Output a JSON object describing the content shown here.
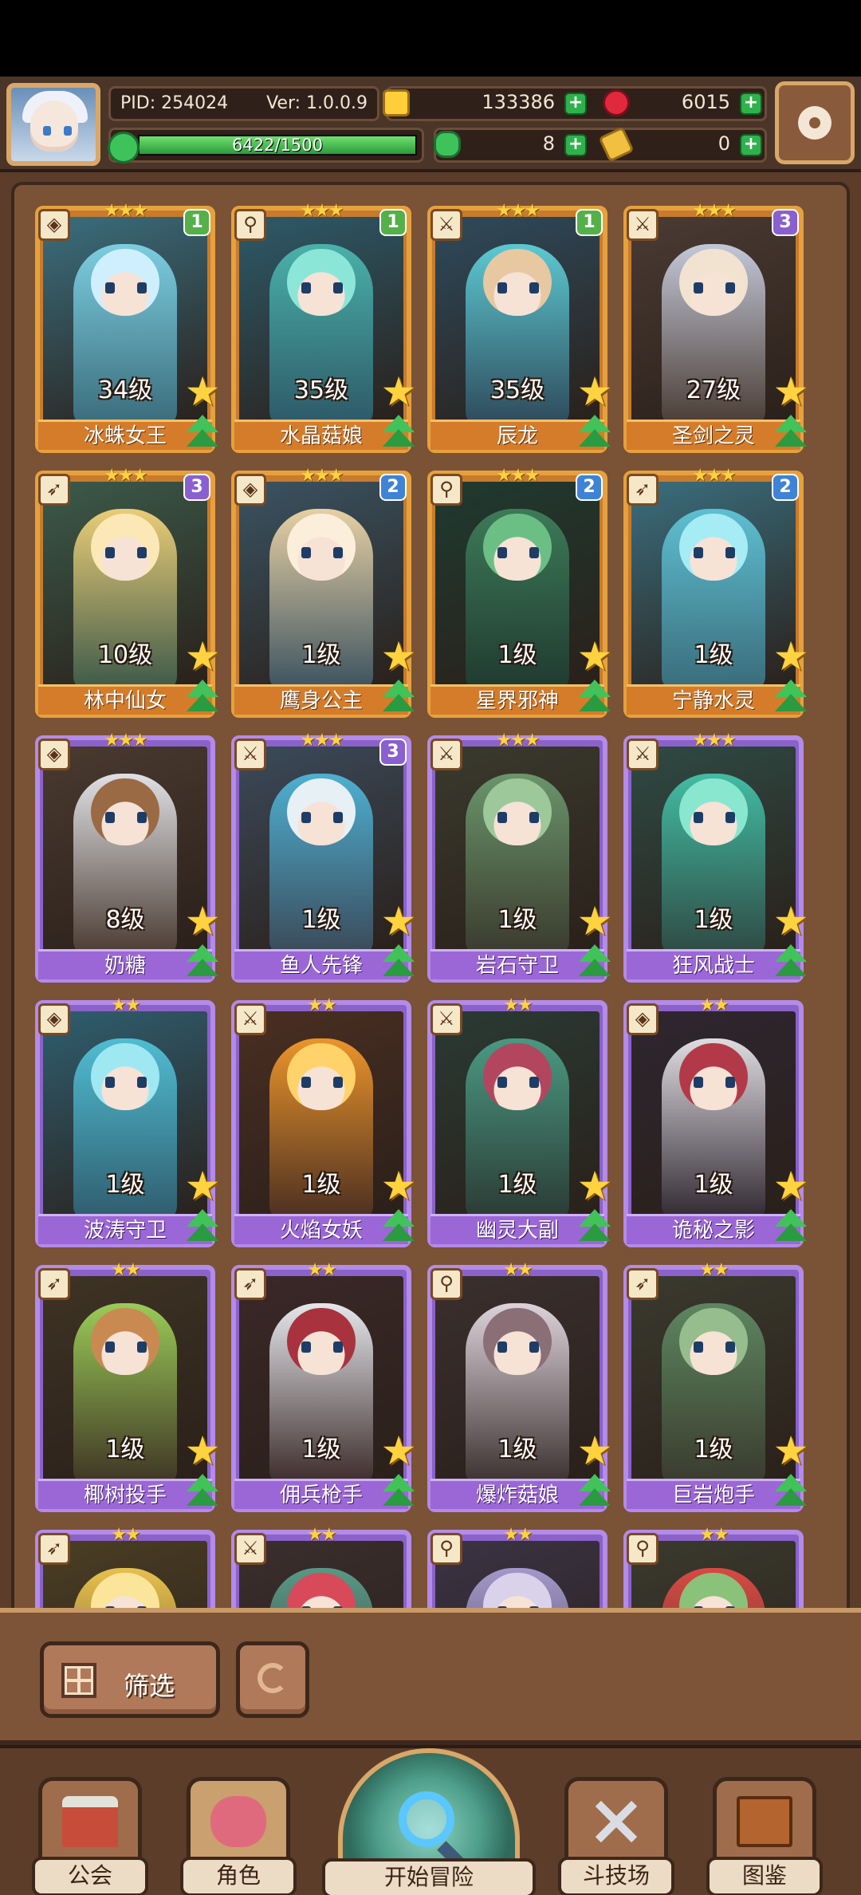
{
  "header": {
    "pid": "PID: 254024",
    "version": "Ver: 1.0.0.9",
    "xp_text": "6422/1500",
    "xp_progress": 1.0,
    "gold": "133386",
    "gems": "6015",
    "clover": "8",
    "ticket": "0"
  },
  "colors": {
    "gold_frame": "#e6a13c",
    "purple_frame": "#b38be8",
    "plus_green": "#2fb24c",
    "panel_brown": "#5b3d2a"
  },
  "cards": [
    {
      "name": "冰蛛女王",
      "level": "34级",
      "stars": "★★★",
      "rank": "1",
      "rank_color": "green",
      "tier": "gold",
      "type_icon": "shield-icon",
      "palette": [
        "#3a6e7e",
        "#7fd3e6",
        "#cfefff"
      ]
    },
    {
      "name": "水晶菇娘",
      "level": "35级",
      "stars": "★★★",
      "rank": "1",
      "rank_color": "green",
      "tier": "gold",
      "type_icon": "staff-icon",
      "palette": [
        "#2d5a6a",
        "#4bb6ad",
        "#8ce6d8"
      ]
    },
    {
      "name": "辰龙",
      "level": "35级",
      "stars": "★★★",
      "rank": "1",
      "rank_color": "green",
      "tier": "gold",
      "type_icon": "sword-icon",
      "palette": [
        "#2e4a5c",
        "#5ed0d8",
        "#e7c8a0"
      ]
    },
    {
      "name": "圣剑之灵",
      "level": "27级",
      "stars": "★★★",
      "rank": "3",
      "rank_color": "purple",
      "tier": "gold",
      "type_icon": "sword-icon",
      "palette": [
        "#4a3b33",
        "#c9cfe0",
        "#f1e3d0"
      ]
    },
    {
      "name": "林中仙女",
      "level": "10级",
      "stars": "★★★",
      "rank": "3",
      "rank_color": "purple",
      "tier": "gold",
      "type_icon": "bow-icon",
      "palette": [
        "#3b5a4a",
        "#f3d37a",
        "#fbe8b6"
      ]
    },
    {
      "name": "鹰身公主",
      "level": "1级",
      "stars": "★★★",
      "rank": "2",
      "rank_color": "blue",
      "tier": "gold",
      "type_icon": "shield-icon",
      "palette": [
        "#3a5362",
        "#efd7a8",
        "#fbeeda"
      ]
    },
    {
      "name": "星界邪神",
      "level": "1级",
      "stars": "★★★",
      "rank": "2",
      "rank_color": "blue",
      "tier": "gold",
      "type_icon": "staff-icon",
      "palette": [
        "#1f3a30",
        "#3e7e5a",
        "#6bbf84"
      ]
    },
    {
      "name": "宁静水灵",
      "level": "1级",
      "stars": "★★★",
      "rank": "2",
      "rank_color": "blue",
      "tier": "gold",
      "type_icon": "bow-icon",
      "palette": [
        "#3a6e7e",
        "#5fc4d6",
        "#a6ecf5"
      ]
    },
    {
      "name": "奶糖",
      "level": "8级",
      "stars": "★★★",
      "rank": "",
      "rank_color": "",
      "tier": "purple",
      "type_icon": "shield-icon",
      "palette": [
        "#4a3a30",
        "#e7e9ee",
        "#9a6a45"
      ]
    },
    {
      "name": "鱼人先锋",
      "level": "1级",
      "stars": "★★★",
      "rank": "3",
      "rank_color": "purple",
      "tier": "purple",
      "type_icon": "sword-icon",
      "palette": [
        "#3b4a5a",
        "#4fb5d8",
        "#e7f0f5"
      ]
    },
    {
      "name": "岩石守卫",
      "level": "1级",
      "stars": "★★★",
      "rank": "",
      "rank_color": "",
      "tier": "purple",
      "type_icon": "sword-icon",
      "palette": [
        "#3a3a2e",
        "#6d9a6e",
        "#9cc89a"
      ]
    },
    {
      "name": "狂风战士",
      "level": "1级",
      "stars": "★★★",
      "rank": "",
      "rank_color": "",
      "tier": "purple",
      "type_icon": "sword-icon",
      "palette": [
        "#2f4a44",
        "#43c2a8",
        "#89e6cf"
      ]
    },
    {
      "name": "波涛守卫",
      "level": "1级",
      "stars": "★★",
      "rank": "",
      "rank_color": "",
      "tier": "purple",
      "type_icon": "shield-icon",
      "palette": [
        "#2f5e70",
        "#52c2d8",
        "#9fe8f2"
      ]
    },
    {
      "name": "火焰女妖",
      "level": "1级",
      "stars": "★★",
      "rank": "",
      "rank_color": "",
      "tier": "purple",
      "type_icon": "sword-icon",
      "palette": [
        "#4a2e22",
        "#f39a2b",
        "#ffd36a"
      ]
    },
    {
      "name": "幽灵大副",
      "level": "1级",
      "stars": "★★",
      "rank": "",
      "rank_color": "",
      "tier": "purple",
      "type_icon": "sword-icon",
      "palette": [
        "#2a3a34",
        "#4c9e86",
        "#b2465e"
      ]
    },
    {
      "name": "诡秘之影",
      "level": "1级",
      "stars": "★★",
      "rank": "",
      "rank_color": "",
      "tier": "purple",
      "type_icon": "shield-icon",
      "palette": [
        "#2e2630",
        "#e8e6ea",
        "#b23a48"
      ]
    },
    {
      "name": "椰树投手",
      "level": "1级",
      "stars": "★★",
      "rank": "",
      "rank_color": "",
      "tier": "purple",
      "type_icon": "bow-icon",
      "palette": [
        "#3e3324",
        "#9fd35a",
        "#c98a52"
      ]
    },
    {
      "name": "佣兵枪手",
      "level": "1级",
      "stars": "★★",
      "rank": "",
      "rank_color": "",
      "tier": "purple",
      "type_icon": "bow-icon",
      "palette": [
        "#3a2828",
        "#eef1f5",
        "#a8323e"
      ]
    },
    {
      "name": "爆炸菇娘",
      "level": "1级",
      "stars": "★★",
      "rank": "",
      "rank_color": "",
      "tier": "purple",
      "type_icon": "staff-icon",
      "palette": [
        "#3a2f2e",
        "#e5dbe3",
        "#8a6f76"
      ]
    },
    {
      "name": "巨岩炮手",
      "level": "1级",
      "stars": "★★",
      "rank": "",
      "rank_color": "",
      "tier": "purple",
      "type_icon": "bow-icon",
      "palette": [
        "#3a3a2e",
        "#5f8a62",
        "#95bd8e"
      ]
    },
    {
      "name": "",
      "level": "",
      "stars": "★★",
      "rank": "",
      "rank_color": "",
      "tier": "purple",
      "type_icon": "bow-icon",
      "palette": [
        "#4a3e24",
        "#f0c850",
        "#fbe59a"
      ]
    },
    {
      "name": "",
      "level": "",
      "stars": "★★",
      "rank": "",
      "rank_color": "",
      "tier": "purple",
      "type_icon": "sword-icon",
      "palette": [
        "#3a2e2e",
        "#5a9e8a",
        "#d84a5a"
      ]
    },
    {
      "name": "",
      "level": "",
      "stars": "★★",
      "rank": "",
      "rank_color": "",
      "tier": "purple",
      "type_icon": "staff-icon",
      "palette": [
        "#3a3344",
        "#a89ed0",
        "#d9d2ea"
      ]
    },
    {
      "name": "",
      "level": "",
      "stars": "★★",
      "rank": "",
      "rank_color": "",
      "tier": "purple",
      "type_icon": "staff-icon",
      "palette": [
        "#3a3a2e",
        "#e04a44",
        "#8ac27a"
      ]
    }
  ],
  "filter": {
    "label": "筛选"
  },
  "nav": {
    "guild": "公会",
    "role": "角色",
    "adventure": "开始冒险",
    "arena": "斗技场",
    "book": "图鉴"
  }
}
